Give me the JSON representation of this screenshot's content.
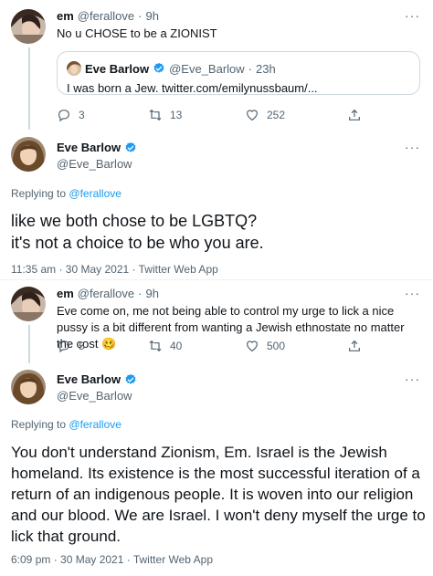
{
  "tweet1": {
    "name": "em",
    "handle": "@ferallove",
    "dot": "·",
    "time": "9h",
    "text": "No u CHOSE to be a ZIONIST",
    "more_icon": "more-icon",
    "quote": {
      "name": "Eve Barlow",
      "handle": "@Eve_Barlow",
      "dot": "·",
      "time": "23h",
      "text": "I was born a Jew. twitter.com/emilynussbaum/..."
    },
    "actions": {
      "replies": "3",
      "retweets": "13",
      "likes": "252"
    }
  },
  "main1": {
    "name": "Eve Barlow",
    "handle": "@Eve_Barlow",
    "replying_prefix": "Replying to",
    "replying_handle": "@ferallove",
    "text_line1": "like we both chose to be LGBTQ?",
    "text_line2": "it's not a choice to be who you are.",
    "meta": "11:35 am · 30 May 2021 · Twitter Web App"
  },
  "tweet2": {
    "name": "em",
    "handle": "@ferallove",
    "dot": "·",
    "time": "9h",
    "text": "Eve come on, me not being able to control my urge to lick a nice pussy is a bit different from wanting a Jewish ethnostate no matter the cost 🥴",
    "actions": {
      "replies": "5",
      "retweets": "40",
      "likes": "500"
    }
  },
  "main2": {
    "name": "Eve Barlow",
    "handle": "@Eve_Barlow",
    "replying_prefix": "Replying to",
    "replying_handle": "@ferallove",
    "text": "You don't understand Zionism, Em. Israel is the Jewish homeland. Its existence is the most successful iteration of a return of an indigenous people. It is woven into our religion and our blood. We are Israel. I won't deny myself the urge to lick that ground.",
    "meta": "6:09 pm · 30 May 2021 · Twitter Web App"
  },
  "colors": {
    "accent": "#1d9bf0",
    "text": "#0f1419",
    "muted": "#536471",
    "border": "#cfd9de"
  }
}
